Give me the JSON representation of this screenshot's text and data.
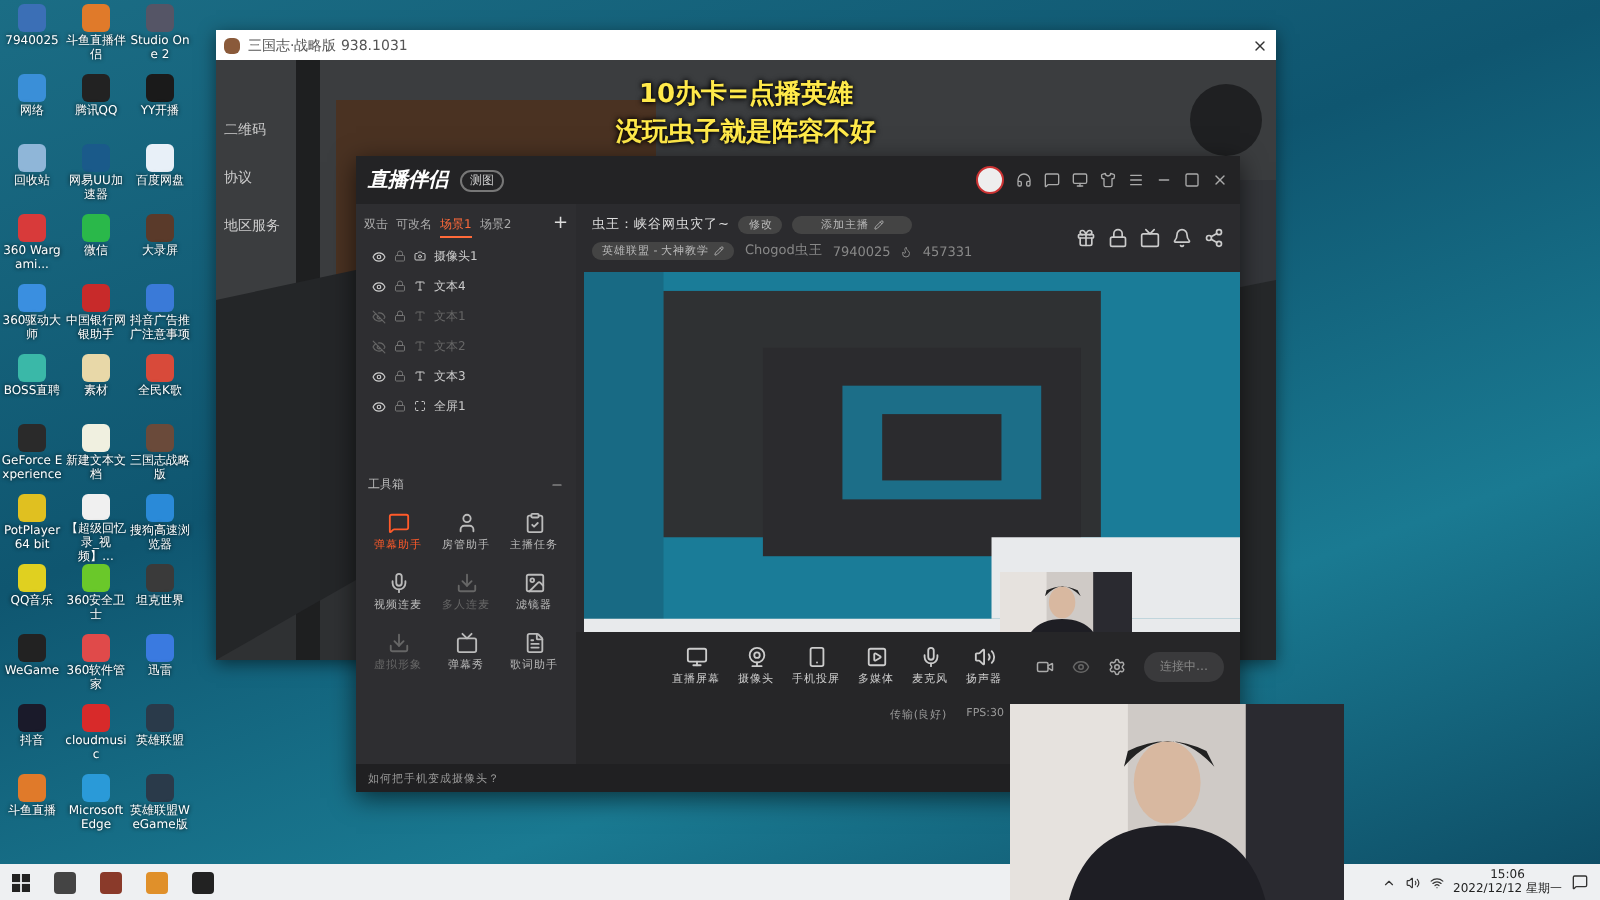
{
  "desktop_icons": [
    {
      "label": "7940025",
      "color": "#3b6fb6"
    },
    {
      "label": "网络",
      "color": "#3a8fd8"
    },
    {
      "label": "回收站",
      "color": "#8fb6d8"
    },
    {
      "label": "360 Wargami...",
      "color": "#d83a3a"
    },
    {
      "label": "360驱动大师",
      "color": "#3a8fe0"
    },
    {
      "label": "BOSS直聘",
      "color": "#3ab8a8"
    },
    {
      "label": "GeForce Experience",
      "color": "#2a2a2a"
    },
    {
      "label": "PotPlayer 64 bit",
      "color": "#e0c020"
    },
    {
      "label": "QQ音乐",
      "color": "#e0d020"
    },
    {
      "label": "WeGame",
      "color": "#222222"
    },
    {
      "label": "抖音",
      "color": "#1a1a2a"
    },
    {
      "label": "斗鱼直播",
      "color": "#e07a2a"
    },
    {
      "label": "斗鱼直播伴侣",
      "color": "#e07a2a"
    },
    {
      "label": "腾讯QQ",
      "color": "#222222"
    },
    {
      "label": "网易UU加速器",
      "color": "#1a5a8a"
    },
    {
      "label": "微信",
      "color": "#2ab84a"
    },
    {
      "label": "中国银行网银助手",
      "color": "#c82a2a"
    },
    {
      "label": "素材",
      "color": "#e8d8a8"
    },
    {
      "label": "新建文本文档",
      "color": "#f0f0e0"
    },
    {
      "label": "【超级回忆录_视频】...",
      "color": "#f0f0f0"
    },
    {
      "label": "360安全卫士",
      "color": "#6ac82a"
    },
    {
      "label": "360软件管家",
      "color": "#e04a4a"
    },
    {
      "label": "cloudmusic",
      "color": "#d82a2a"
    },
    {
      "label": "Microsoft Edge",
      "color": "#2a9ad8"
    },
    {
      "label": "Studio One 2",
      "color": "#555566"
    },
    {
      "label": "YY开播",
      "color": "#1a1a1a"
    },
    {
      "label": "百度网盘",
      "color": "#e8f0f8"
    },
    {
      "label": "大录屏",
      "color": "#5a3a2a"
    },
    {
      "label": "抖音广告推广注意事项",
      "color": "#3a7ad8"
    },
    {
      "label": "全民K歌",
      "color": "#d84a3a"
    },
    {
      "label": "三国志战略版",
      "color": "#6a4a3a"
    },
    {
      "label": "搜狗高速浏览器",
      "color": "#2a8ad8"
    },
    {
      "label": "坦克世界",
      "color": "#3a3a3a"
    },
    {
      "label": "迅雷",
      "color": "#3a7ae0"
    },
    {
      "label": "英雄联盟",
      "color": "#2a3a4a"
    },
    {
      "label": "英雄联盟WeGame版",
      "color": "#2a3a4a"
    }
  ],
  "game_window": {
    "title": "三国志·战略版  938.1031",
    "side_labels": [
      "二维码",
      "协议",
      "地区服务"
    ],
    "caption": [
      "10办卡=点播英雄",
      "没玩虫子就是阵容不好"
    ]
  },
  "live_app": {
    "logo": "直播伴侣",
    "badge": "测图",
    "scene_tabs": [
      {
        "label": "双击",
        "selected": false
      },
      {
        "label": "可改名",
        "selected": false
      },
      {
        "label": "场景1",
        "selected": true
      },
      {
        "label": "场景2",
        "selected": false
      }
    ],
    "add_tab": "+",
    "sources": [
      {
        "label": "摄像头1",
        "visible": true
      },
      {
        "label": "文本4",
        "visible": true
      },
      {
        "label": "文本1",
        "visible": false
      },
      {
        "label": "文本2",
        "visible": false
      },
      {
        "label": "文本3",
        "visible": true
      },
      {
        "label": "全屏1",
        "visible": true
      }
    ],
    "toolbox_title": "工具箱",
    "tools": [
      {
        "label": "弹幕助手",
        "selected": true,
        "disabled": false
      },
      {
        "label": "房管助手",
        "selected": false,
        "disabled": false
      },
      {
        "label": "主播任务",
        "selected": false,
        "disabled": false
      },
      {
        "label": "视频连麦",
        "selected": false,
        "disabled": false
      },
      {
        "label": "多人连麦",
        "selected": false,
        "disabled": true
      },
      {
        "label": "滤镜器",
        "selected": false,
        "disabled": false
      },
      {
        "label": "虚拟形象",
        "selected": false,
        "disabled": true
      },
      {
        "label": "弹幕秀",
        "selected": false,
        "disabled": false
      },
      {
        "label": "歌词助手",
        "selected": false,
        "disabled": false
      }
    ],
    "room_title": "虫王：峡谷网虫灾了~",
    "edit_button": "修改",
    "announce_button": "添加主播",
    "category": "英雄联盟 - 大神教学",
    "streamer": "Chogod虫王",
    "room_id": "7940025",
    "popularity": "457331",
    "controls": [
      {
        "label": "直播屏幕"
      },
      {
        "label": "摄像头"
      },
      {
        "label": "手机投屏"
      },
      {
        "label": "多媒体"
      },
      {
        "label": "麦克风"
      },
      {
        "label": "扬声器"
      }
    ],
    "start_button": "连接中…",
    "notice": "如何把手机变成摄像头？",
    "status": "传输(良好)",
    "fps": "FPS:30"
  },
  "taskbar": {
    "time": "15:06",
    "date": "2022/12/12 星期一"
  }
}
